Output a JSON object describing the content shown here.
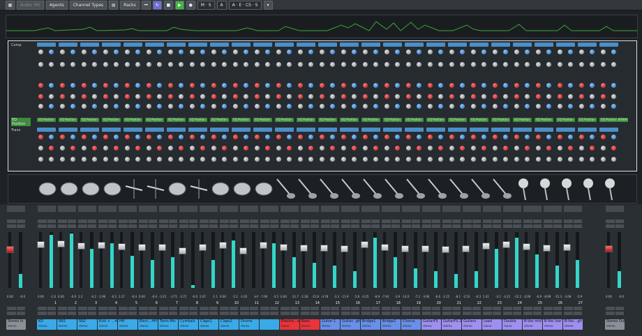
{
  "toolbar": {
    "mode_label": "Audio (M)",
    "agents_label": "Agents",
    "channel_types_label": "Channel Types",
    "racks_label": "Racks",
    "ms_label": "M · S",
    "a_label": "A",
    "a_e_cs_s_label": "A · E · CS · S"
  },
  "racks": {
    "left_labels": [
      "Comp",
      "EQ Position",
      "Trans"
    ],
    "right_labels": [
      "Comp",
      "EQ Position",
      "Trans"
    ],
    "eq_label": "EQ Position",
    "noise_gate_label": "Noise Gate"
  },
  "mixer": {
    "left_channel": {
      "name": "Stereo In",
      "type": "stereo",
      "vol": "0.00",
      "pan": "-0.0"
    },
    "right_channel": {
      "name": "Stereo Out",
      "type": "stereo",
      "vol": "0.00",
      "pan": "-0.0"
    },
    "channels": [
      {
        "num": "1",
        "name": "KD",
        "type": "stereo",
        "vol": "0.00",
        "pan": "-1.0",
        "color": "#3aa9e8",
        "level": 0.95
      },
      {
        "num": "2",
        "name": "SN1",
        "type": "stereo",
        "vol": "0.00",
        "pan": "-0.0",
        "color": "#3aa9e8",
        "level": 0.98
      },
      {
        "num": "3",
        "name": "SN2",
        "type": "stereo",
        "vol": "2.2",
        "pan": "-0.2",
        "color": "#3aa9e8",
        "level": 0.7
      },
      {
        "num": "4",
        "name": "Kick + ...re",
        "type": "stereo",
        "vol": "-2.96",
        "pan": "-0.2",
        "color": "#3aa9e8",
        "level": 0.8
      },
      {
        "num": "5",
        "name": "HH",
        "type": "stereo",
        "vol": "2.27",
        "pan": "-6.4",
        "color": "#3aa9e8",
        "level": 0.58
      },
      {
        "num": "6",
        "name": "Elect…HH",
        "type": "stereo",
        "vol": "0.00",
        "pan": "-6.4",
        "color": "#3aa9e8",
        "level": 0.5
      },
      {
        "num": "7",
        "name": "Toms-Mic",
        "type": "stereo",
        "vol": "-3.21",
        "pan": "-3.71",
        "color": "#3aa9e8",
        "level": 0.55
      },
      {
        "num": "8",
        "name": "Cymbals",
        "type": "stereo",
        "vol": "-3.71",
        "pan": "-6.0",
        "color": "#3aa9e8",
        "level": 0.05
      },
      {
        "num": "9",
        "name": "Claps1",
        "type": "stereo",
        "vol": "2.07",
        "pan": "-1.1",
        "color": "#3aa9e8",
        "level": 0.5
      },
      {
        "num": "10",
        "name": "Claps2",
        "type": "stereo",
        "vol": "0.00",
        "pan": "-5.1",
        "color": "#3aa9e8",
        "level": 0.85
      },
      {
        "num": "11",
        "name": "Drums",
        "type": "stereo",
        "vol": "-1.62",
        "pan": "-inf",
        "color": "#3aa9e8",
        "level": 0.0
      },
      {
        "num": "12",
        "name": "",
        "type": "",
        "vol": "-7.60",
        "pan": "-3.5",
        "color": "#3aa9e8",
        "level": 0.8
      },
      {
        "num": "13",
        "name": "Electric...ass",
        "type": "mono",
        "vol": "0.00",
        "pan": "-11.7",
        "color": "#e8343a",
        "level": 0.55
      },
      {
        "num": "14",
        "name": "Bass",
        "type": "stereo",
        "vol": "-1.28",
        "pan": "-15.8",
        "color": "#e8343a",
        "level": 0.45
      },
      {
        "num": "15",
        "name": "Guitar 1",
        "type": "stereo",
        "vol": "-4.78",
        "pan": "-3.3",
        "color": "#6a8fe8",
        "level": 0.4
      },
      {
        "num": "16",
        "name": "Guitar...gh",
        "type": "stereo",
        "vol": "-11.9",
        "pan": "-5.8",
        "color": "#6a8fe8",
        "level": 0.3
      },
      {
        "num": "17",
        "name": "Bridge1",
        "type": "stereo",
        "vol": "-4.25",
        "pan": "-8.9",
        "color": "#6a8fe8",
        "level": 0.9
      },
      {
        "num": "18",
        "name": "Bridge2",
        "type": "stereo",
        "vol": "-7.93",
        "pan": "-3.9",
        "color": "#6a8fe8",
        "level": 0.55
      },
      {
        "num": "19",
        "name": "Chorus",
        "type": "stereo",
        "vol": "-14.0",
        "pan": "-7.2",
        "color": "#6a8fe8",
        "level": 0.35
      },
      {
        "num": "20",
        "name": "GuitarFX",
        "type": "stereo",
        "vol": "-3.90",
        "pan": "-6.6",
        "color": "#9e8ff0",
        "level": 0.3
      },
      {
        "num": "21",
        "name": "GuitarFX 2",
        "type": "stereo",
        "vol": "-2.15",
        "pan": "-8.1",
        "color": "#9e8ff0",
        "level": 0.25
      },
      {
        "num": "22",
        "name": "Guitars",
        "type": "stereo",
        "vol": "-2.53",
        "pan": "-6.3",
        "color": "#9e8ff0",
        "level": 0.3
      },
      {
        "num": "23",
        "name": "Lead",
        "type": "mono",
        "vol": "1.41",
        "pan": "-3.1",
        "color": "#9e8ff0",
        "level": 0.7
      },
      {
        "num": "24",
        "name": "Double",
        "type": "mono",
        "vol": "-4.21",
        "pan": "-12.2",
        "color": "#9e8ff0",
        "level": 0.9
      },
      {
        "num": "25",
        "name": "B-Voc mid",
        "type": "stereo",
        "vol": "-2.09",
        "pan": "-6.9",
        "color": "#9e8ff0",
        "level": 0.6
      },
      {
        "num": "26",
        "name": "B-Voc low",
        "type": "stereo",
        "vol": "-8.99",
        "pan": "-15.3",
        "color": "#9e8ff0",
        "level": 0.4
      },
      {
        "num": "27",
        "name": "B-Voc...gh",
        "type": "stereo",
        "vol": "-3.08",
        "pan": "-5.9",
        "color": "#9e8ff0",
        "level": 0.5
      }
    ]
  },
  "colors": {
    "meter": "#34d6c8",
    "selected_rack_border": "#d8dde1",
    "play": "#3fb83f",
    "cycle": "#6f6cd8"
  }
}
